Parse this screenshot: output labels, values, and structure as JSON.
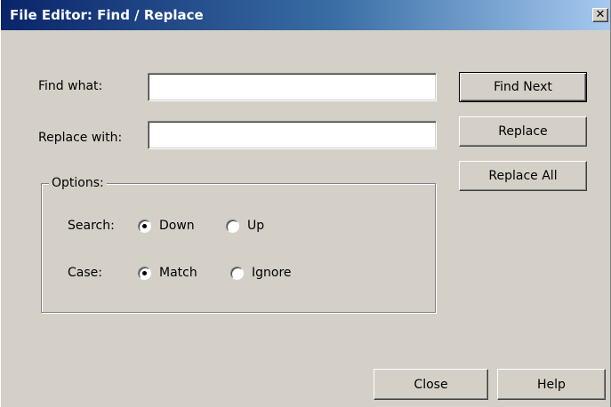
{
  "window": {
    "title": "File Editor: Find / Replace",
    "close_glyph": "✕"
  },
  "fields": {
    "find_label": "Find what:",
    "find_value": "",
    "replace_label": "Replace with:",
    "replace_value": ""
  },
  "buttons": {
    "find_next": "Find Next",
    "replace": "Replace",
    "replace_all": "Replace All",
    "close": "Close",
    "help": "Help"
  },
  "options": {
    "legend": "Options:",
    "search_label": "Search:",
    "search_down": "Down",
    "search_up": "Up",
    "search_selected": "Down",
    "case_label": "Case:",
    "case_match": "Match",
    "case_ignore": "Ignore",
    "case_selected": "Match"
  },
  "icons": {
    "close": "close-icon",
    "radio": "radio-icon"
  },
  "colors": {
    "dialog_background": "#d4d0c8",
    "title_gradient_start": "#0a246a",
    "title_gradient_end": "#a6caf0",
    "title_text": "#ffffff"
  }
}
